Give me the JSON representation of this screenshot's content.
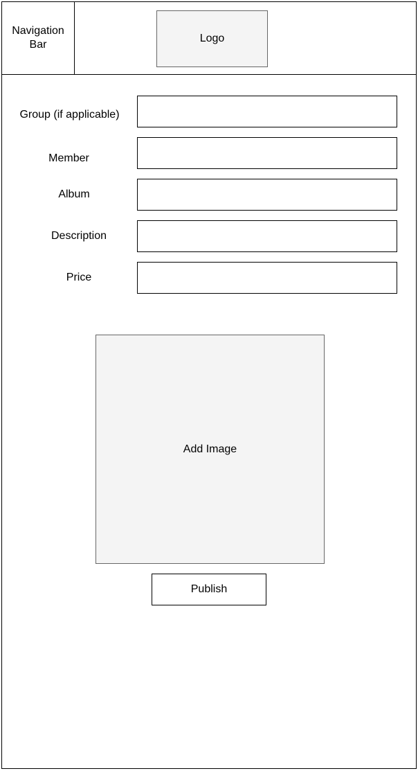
{
  "header": {
    "nav_label": "Navigation\nBar",
    "logo_label": "Logo"
  },
  "form": {
    "fields": [
      {
        "label": "Group (if applicable)",
        "value": ""
      },
      {
        "label": "Member",
        "value": ""
      },
      {
        "label": "Album",
        "value": ""
      },
      {
        "label": "Description",
        "value": ""
      },
      {
        "label": "Price",
        "value": ""
      }
    ]
  },
  "image_upload": {
    "label": "Add Image"
  },
  "actions": {
    "publish_label": "Publish"
  }
}
